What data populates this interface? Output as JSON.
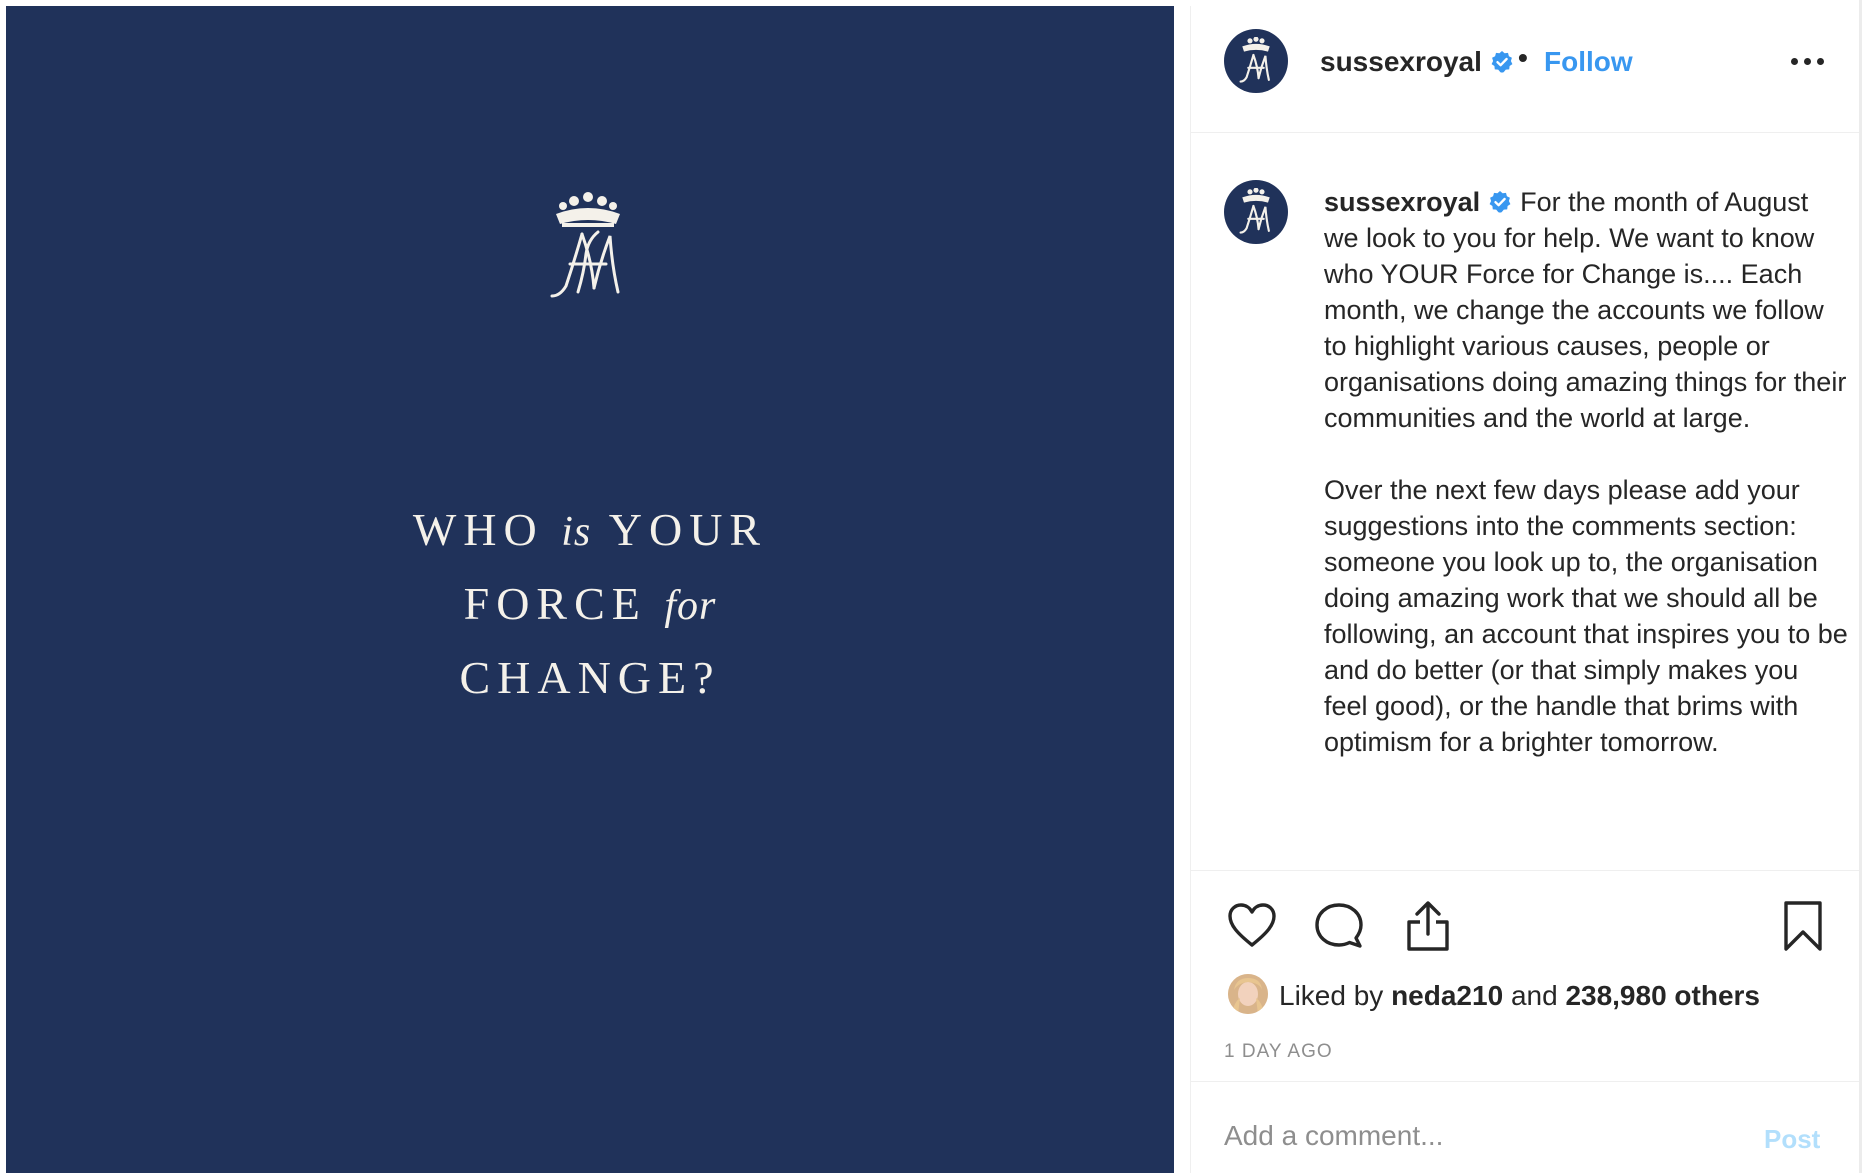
{
  "post_image": {
    "headline_line1_a": "WHO",
    "headline_line1_b": "is",
    "headline_line1_c": "YOUR",
    "headline_line2_a": "FORCE",
    "headline_line2_b": "for",
    "headline_line3": "CHANGE?",
    "background_color": "#20325a"
  },
  "header": {
    "username": "sussexroyal",
    "separator": "•",
    "follow_label": "Follow",
    "more_icon": "more-horizontal-icon"
  },
  "caption": {
    "username": "sussexroyal",
    "paragraph1": "For the month of August we look to you for help. We want to know who YOUR Force for Change is.... Each month, we change the accounts we follow to highlight various causes, people or organisations doing amazing things for their communities and the world at large.",
    "paragraph2": "Over the next few days please add your suggestions into the comments section: someone you look up to, the organisation doing amazing work that we should all be following, an account that inspires you to be and do better (or that simply makes you feel good), or the handle that brims with optimism for a brighter tomorrow."
  },
  "actions": {
    "like_icon": "heart-icon",
    "comment_icon": "comment-bubble-icon",
    "share_icon": "share-icon",
    "save_icon": "bookmark-icon"
  },
  "likes": {
    "prefix": "Liked by",
    "first_user": "neda210",
    "joiner": "and",
    "others": "238,980 others"
  },
  "timestamp": "1 DAY AGO",
  "comment_box": {
    "placeholder": "Add a comment...",
    "post_label": "Post"
  },
  "colors": {
    "accent": "#3897f0",
    "post_disabled": "#b2dffc",
    "navy": "#20325a"
  }
}
